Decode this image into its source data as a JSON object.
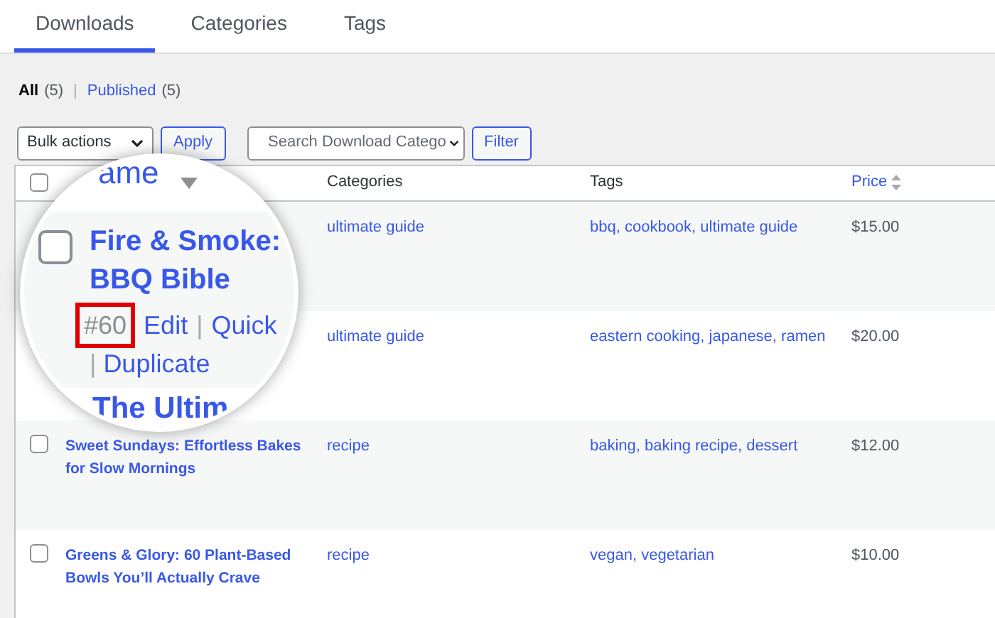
{
  "tabs": [
    {
      "label": "Downloads",
      "selected": true
    },
    {
      "label": "Categories",
      "selected": false
    },
    {
      "label": "Tags",
      "selected": false
    }
  ],
  "views": [
    {
      "label": "All",
      "count": "(5)",
      "selected": true
    },
    {
      "label": "Published",
      "count": "(5)",
      "selected": false
    }
  ],
  "view_separator": "|",
  "toolbar": {
    "bulk_actions": "Bulk actions",
    "apply": "Apply",
    "category_search": {
      "placeholder": "Search Download Catego"
    },
    "filter": "Filter"
  },
  "table": {
    "header_checked": false,
    "columns": [
      {
        "label": "Categories",
        "sortable": false
      },
      {
        "label": "Tags",
        "sortable": false
      },
      {
        "label": "Price",
        "sortable": true
      }
    ],
    "rows": [
      {
        "categories": "ultimate guide",
        "tags": "bbq, cookbook, ultimate guide",
        "price": "$15.00"
      },
      {
        "categories": "ultimate guide",
        "tags": "eastern cooking, japanese, ramen",
        "price": "$20.00"
      },
      {
        "checked": false,
        "name": "Sweet Sundays: Effortless Bakes for Slow Mornings",
        "categories": "recipe",
        "tags": "baking, baking recipe, dessert",
        "price": "$12.00"
      },
      {
        "checked": false,
        "name": "Greens & Glory: 60 Plant-Based Bowls You’ll Actually Crave",
        "categories": "recipe",
        "tags": "vegan, vegetarian",
        "price": "$10.00"
      }
    ]
  },
  "magnifier": {
    "header_fragment": "ame",
    "checked": false,
    "title_lines": [
      "Fire & Smoke:",
      "BBQ Bible"
    ],
    "id": "#60",
    "actions": [
      {
        "label": "Edit"
      },
      {
        "label": "Quick"
      },
      {
        "label": "Duplicate"
      }
    ],
    "separator": "|",
    "next_title": "The Ultim"
  }
}
